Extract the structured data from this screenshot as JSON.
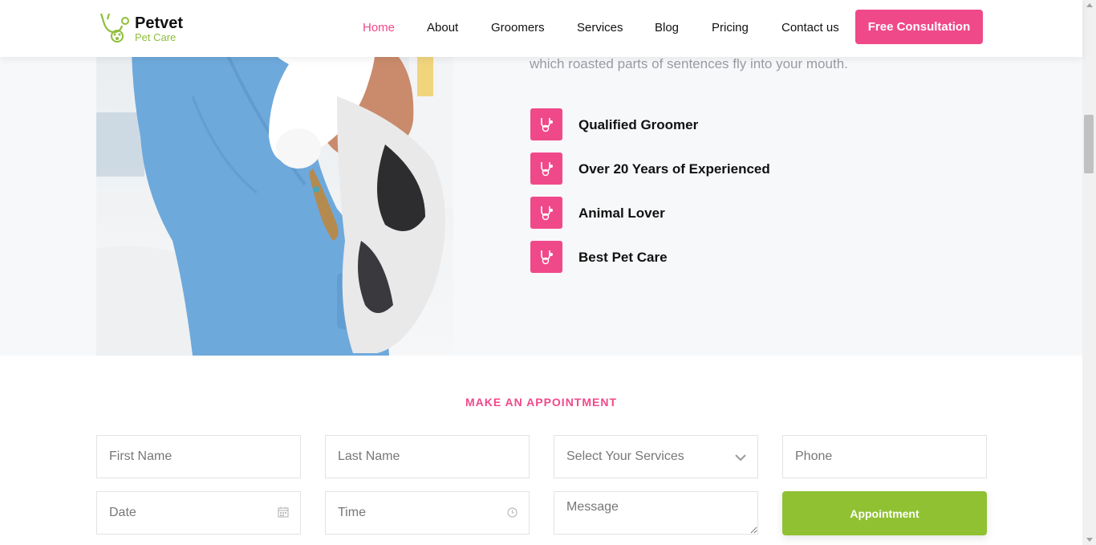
{
  "brand": {
    "name": "Petvet",
    "tagline": "Pet Care"
  },
  "nav": {
    "items": [
      {
        "label": "Home",
        "active": true
      },
      {
        "label": "About"
      },
      {
        "label": "Groomers"
      },
      {
        "label": "Services"
      },
      {
        "label": "Blog"
      },
      {
        "label": "Pricing"
      },
      {
        "label": "Contact us"
      }
    ],
    "cta_label": "Free Consultation"
  },
  "hero": {
    "text": "which roasted parts of sentences fly into your mouth.",
    "features": [
      {
        "label": "Qualified Groomer",
        "icon": "stethoscope-icon"
      },
      {
        "label": "Over 20 Years of Experienced",
        "icon": "stethoscope-icon"
      },
      {
        "label": "Animal Lover",
        "icon": "stethoscope-icon"
      },
      {
        "label": "Best Pet Care",
        "icon": "stethoscope-icon"
      }
    ]
  },
  "appointment": {
    "heading": "MAKE AN APPOINTMENT",
    "first_name_placeholder": "First Name",
    "last_name_placeholder": "Last Name",
    "service_select_value": "Select Your Services",
    "phone_placeholder": "Phone",
    "date_placeholder": "Date",
    "time_placeholder": "Time",
    "message_placeholder": "Message",
    "submit_label": "Appointment"
  },
  "colors": {
    "accent_pink": "#f0498a",
    "accent_green": "#8fc133",
    "hero_bg": "#f7f8fa"
  }
}
